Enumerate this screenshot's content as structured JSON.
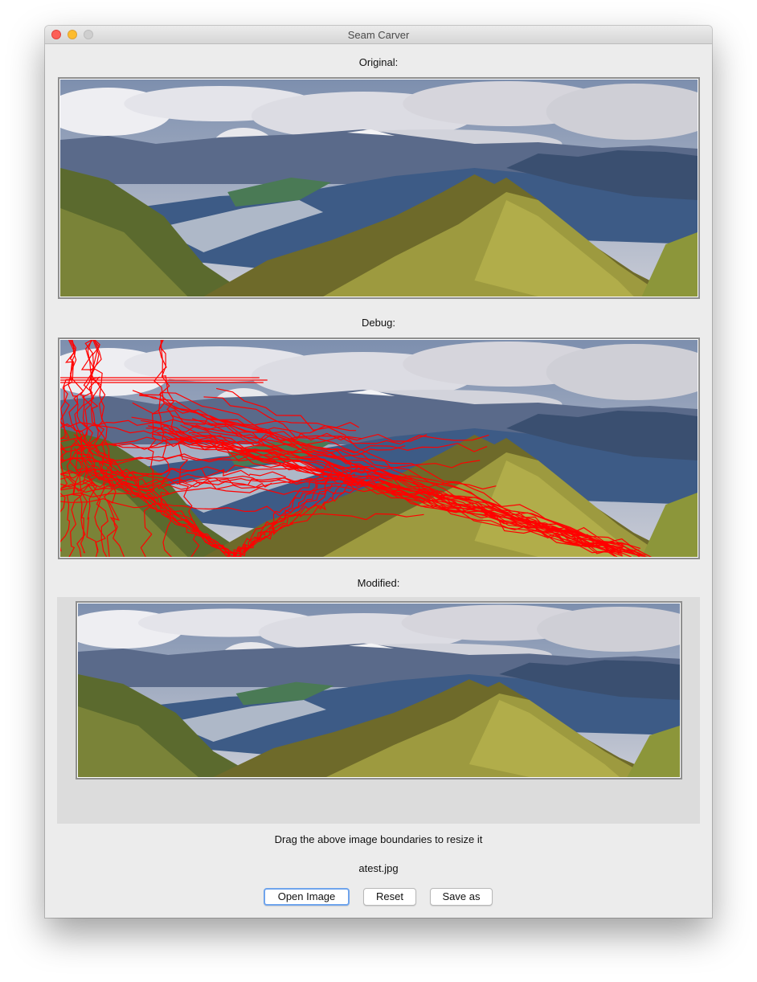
{
  "window": {
    "title": "Seam Carver"
  },
  "sections": {
    "original_label": "Original:",
    "debug_label": "Debug:",
    "modified_label": "Modified:"
  },
  "hint": "Drag the above image boundaries to resize it",
  "filename": "atest.jpg",
  "buttons": {
    "open": "Open Image",
    "reset": "Reset",
    "save": "Save as"
  },
  "colors": {
    "seam": "#ff0000",
    "default_button_focus": "#6fa4ec"
  }
}
